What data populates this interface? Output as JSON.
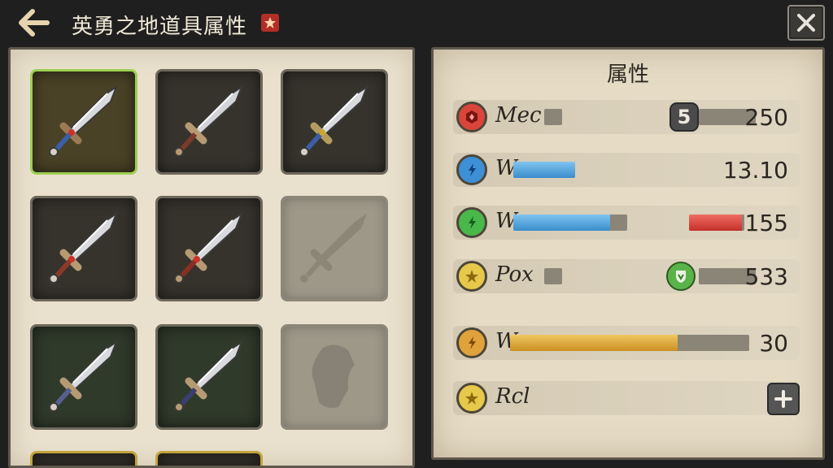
{
  "header": {
    "title": "英勇之地道具属性",
    "back_icon": "back-arrow-icon",
    "close_icon": "close-icon",
    "accent": "#b12f26"
  },
  "inventory": {
    "slots": [
      {
        "icon": "sword-icon",
        "state": "selected"
      },
      {
        "icon": "sword-icon",
        "state": "normal"
      },
      {
        "icon": "sword-icon",
        "state": "normal"
      },
      {
        "icon": "sword-icon",
        "state": "normal"
      },
      {
        "icon": "sword-icon",
        "state": "normal"
      },
      {
        "icon": "sword-icon",
        "state": "locked"
      },
      {
        "icon": "sword-icon",
        "state": "normal"
      },
      {
        "icon": "sword-icon",
        "state": "normal"
      },
      {
        "icon": "armor-icon",
        "state": "locked"
      }
    ]
  },
  "attributes": {
    "title": "属性",
    "rows": [
      {
        "label": "Mec",
        "icon": "red-gem-icon",
        "badge": "5",
        "bar_fill": 0.0,
        "value": "250"
      },
      {
        "label": "W",
        "icon": "blue-gem-icon",
        "bar_fill": 1.0,
        "value": "13.10"
      },
      {
        "label": "W",
        "icon": "green-gem-icon",
        "bar_fill": 0.85,
        "second_bar_fill": 0.95,
        "value": "155"
      },
      {
        "label": "Pox",
        "icon": "yellow-gem-icon",
        "badge_icon": "shield-badge-icon",
        "bar_fill": 0.0,
        "value": "533"
      },
      {
        "label": "W",
        "icon": "orange-gem-icon",
        "bar_fill": 0.7,
        "value": "30"
      },
      {
        "label": "Rcl",
        "icon": "yellow-gem-icon",
        "action_icon": "plus-icon"
      }
    ]
  }
}
